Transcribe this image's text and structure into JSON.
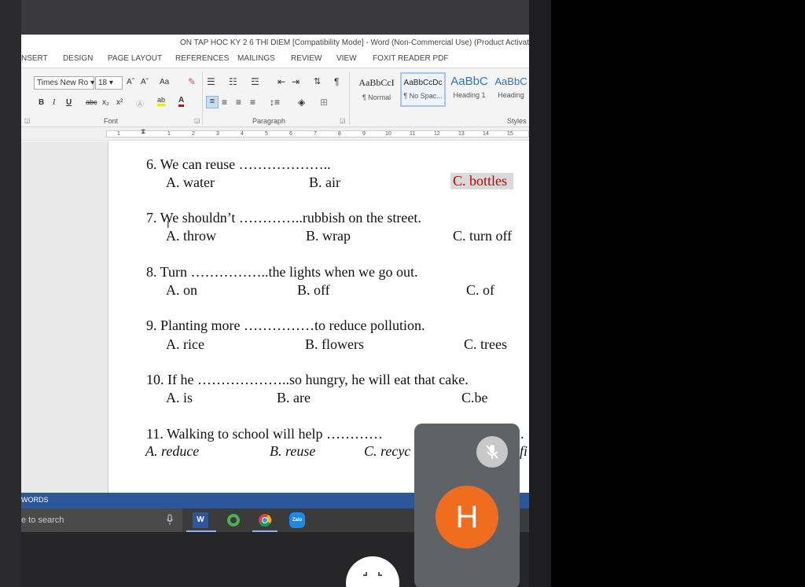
{
  "window": {
    "title": "ON TAP HOC KY 2 6 THI DIEM [Compatibility Mode] - Word (Non-Commercial Use) (Product Activatio"
  },
  "ribbon_tabs": [
    "NSERT",
    "DESIGN",
    "PAGE LAYOUT",
    "REFERENCES",
    "MAILINGS",
    "REVIEW",
    "VIEW",
    "FOXIT READER PDF"
  ],
  "font_group": {
    "font_name": "Times New Ro",
    "font_size": "18",
    "grow_label": "Aˆ",
    "shrink_label": "Aˇ",
    "case_label": "Aa",
    "bold": "B",
    "italic": "I",
    "underline": "U",
    "strike": "abc",
    "subscript": "x₂",
    "superscript": "x²",
    "label": "Font"
  },
  "paragraph_group": {
    "label": "Paragraph",
    "pilcrow": "¶"
  },
  "styles_group": {
    "label": "Styles",
    "items": [
      {
        "sample": "AaBbCcI",
        "name": "¶ Normal"
      },
      {
        "sample": "AaBbCcDc",
        "name": "¶ No Spac..."
      },
      {
        "sample": "AaBbC",
        "name": "Heading 1"
      },
      {
        "sample": "AaBbC",
        "name": "Heading"
      }
    ]
  },
  "ruler": [
    "1",
    "1",
    "2",
    "3",
    "4",
    "5",
    "6",
    "7",
    "8",
    "9",
    "10",
    "11",
    "12",
    "13",
    "14",
    "15"
  ],
  "document": {
    "questions": [
      {
        "text": "6. We can reuse ………………..",
        "options": [
          "A. water",
          "B. air",
          "C. bottles"
        ]
      },
      {
        "text": "7. We shouldn’t …………..rubbish on the street.",
        "options": [
          "A. throw",
          "B. wrap",
          "C. turn off"
        ]
      },
      {
        "text": "8. Turn ……………..the lights when we go out.",
        "options": [
          "A. on",
          "B. off",
          "C. of"
        ]
      },
      {
        "text": "9. Planting more ……………to reduce pollution.",
        "options": [
          "A. rice",
          "B. flowers",
          "C. trees"
        ]
      },
      {
        "text": "10. If he ………………..so hungry, he will eat that cake.",
        "options": [
          "A. is",
          "B. are",
          "C.be"
        ]
      },
      {
        "text": "11. Walking to school will help …………",
        "options": [
          "A. reduce",
          "B. reuse",
          "C. recyc"
        ]
      }
    ],
    "q11_tail": ".",
    "q11_option_tail": "fi"
  },
  "status_bar": {
    "words_label": "WORDS"
  },
  "taskbar": {
    "search_text": "e to search",
    "apps": [
      "word-icon",
      "edge-icon",
      "chrome-icon",
      "zalo-icon"
    ],
    "zalo_label": "Zalo"
  },
  "call": {
    "avatar_letter": "H"
  },
  "colors": {
    "status_blue": "#2b579a",
    "answer_red": "#c00000",
    "avatar_orange": "#f06d1f"
  }
}
